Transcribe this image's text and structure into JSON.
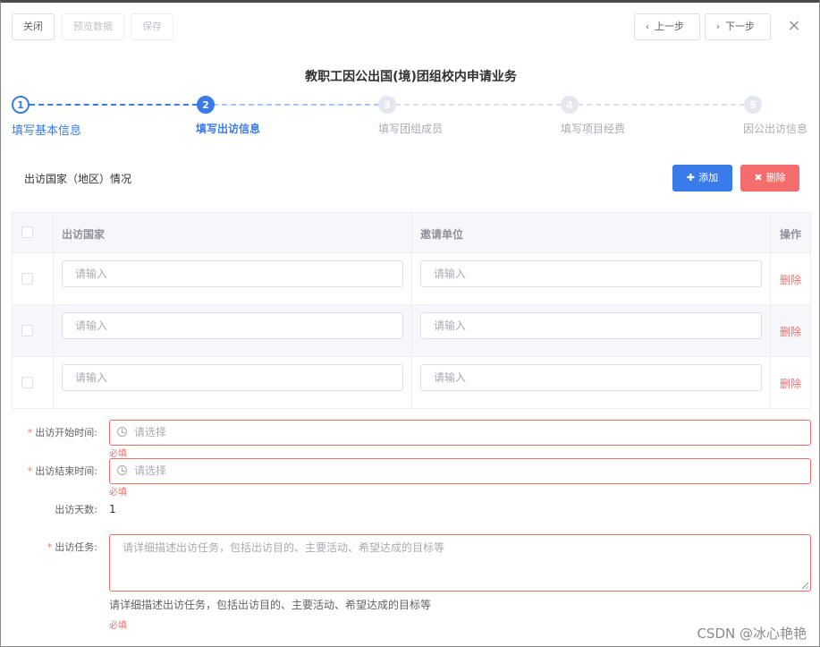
{
  "toolbar": {
    "close": "关闭",
    "preview": "预览数据",
    "save": "保存",
    "prev": "上一步",
    "next": "下一步",
    "dismiss": "×"
  },
  "title": "教职工因公出国(境)团组校内申请业务",
  "steps": [
    {
      "num": "1",
      "label": "填写基本信息",
      "state": "done"
    },
    {
      "num": "2",
      "label": "填写出访信息",
      "state": "active"
    },
    {
      "num": "3",
      "label": "填写团组成员",
      "state": "wait"
    },
    {
      "num": "4",
      "label": "填写项目经费",
      "state": "wait"
    },
    {
      "num": "5",
      "label": "因公出访信息",
      "state": "wait"
    }
  ],
  "section": {
    "title": "出访国家（地区）情况",
    "add": "添加",
    "delete": "删除"
  },
  "table": {
    "headers": {
      "country": "出访国家",
      "org": "邀请单位",
      "ops": "操作"
    },
    "rows": [
      {
        "country_placeholder": "请输入",
        "org_placeholder": "请输入",
        "action": "删除"
      },
      {
        "country_placeholder": "请输入",
        "org_placeholder": "请输入",
        "action": "删除"
      },
      {
        "country_placeholder": "请输入",
        "org_placeholder": "请输入",
        "action": "删除"
      }
    ]
  },
  "form": {
    "start_label": "出访开始时间:",
    "start_placeholder": "请选择",
    "end_label": "出访结束时间:",
    "end_placeholder": "请选择",
    "required_msg": "必填",
    "days_label": "出访天数:",
    "days_value": "1",
    "task_label": "出访任务:",
    "task_placeholder": "请详细描述出访任务，包括出访目的、主要活动、希望达成的目标等",
    "task_hint": "请详细描述出访任务，包括出访目的、主要活动、希望达成的目标等"
  },
  "watermark": "CSDN @冰心艳艳",
  "colors": {
    "primary": "#3a7bea",
    "danger": "#f56c6c"
  }
}
